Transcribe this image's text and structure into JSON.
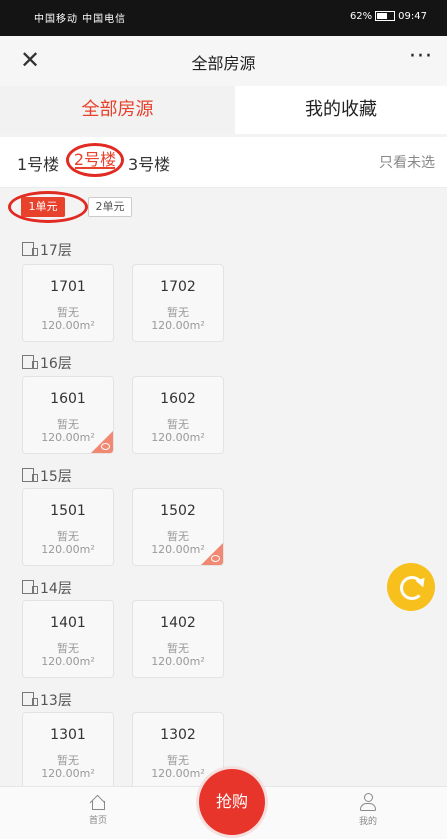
{
  "status_bar": {
    "carrier": "中国移动 中国电信",
    "battery": "62%",
    "time": "09:47"
  },
  "nav": {
    "title": "全部房源",
    "close_icon": "close-icon",
    "more_icon": "more-icon"
  },
  "tabs": [
    {
      "label": "全部房源",
      "active": true
    },
    {
      "label": "我的收藏",
      "active": false
    }
  ],
  "buildings": {
    "items": [
      "1号楼",
      "2号楼",
      "3号楼"
    ],
    "selected": "2号楼",
    "filter": "只看未选"
  },
  "units": {
    "items": [
      "1单元",
      "2单元"
    ],
    "selected": "1单元"
  },
  "floors": [
    {
      "label": "17层",
      "rooms": [
        {
          "number": "1701",
          "status": "暂无",
          "area": "120.00m²"
        },
        {
          "number": "1702",
          "status": "暂无",
          "area": "120.00m²"
        }
      ]
    },
    {
      "label": "16层",
      "rooms": [
        {
          "number": "1601",
          "status": "暂无",
          "area": "120.00m²"
        },
        {
          "number": "1602",
          "status": "暂无",
          "area": "120.00m²"
        }
      ]
    },
    {
      "label": "15层",
      "rooms": [
        {
          "number": "1501",
          "status": "暂无",
          "area": "120.00m²"
        },
        {
          "number": "1502",
          "status": "暂无",
          "area": "120.00m²"
        }
      ]
    },
    {
      "label": "14层",
      "rooms": [
        {
          "number": "1401",
          "status": "暂无",
          "area": "120.00m²"
        },
        {
          "number": "1402",
          "status": "暂无",
          "area": "120.00m²"
        }
      ]
    },
    {
      "label": "13层",
      "rooms": [
        {
          "number": "1301",
          "status": "暂无",
          "area": "120.00m²"
        },
        {
          "number": "1302",
          "status": "暂无",
          "area": "120.00m²"
        }
      ]
    }
  ],
  "bottom_bar": {
    "home": "首页",
    "buy": "抢购",
    "mine": "我的"
  },
  "colors": {
    "accent": "#e8412c",
    "refresh": "#f7c01d"
  }
}
